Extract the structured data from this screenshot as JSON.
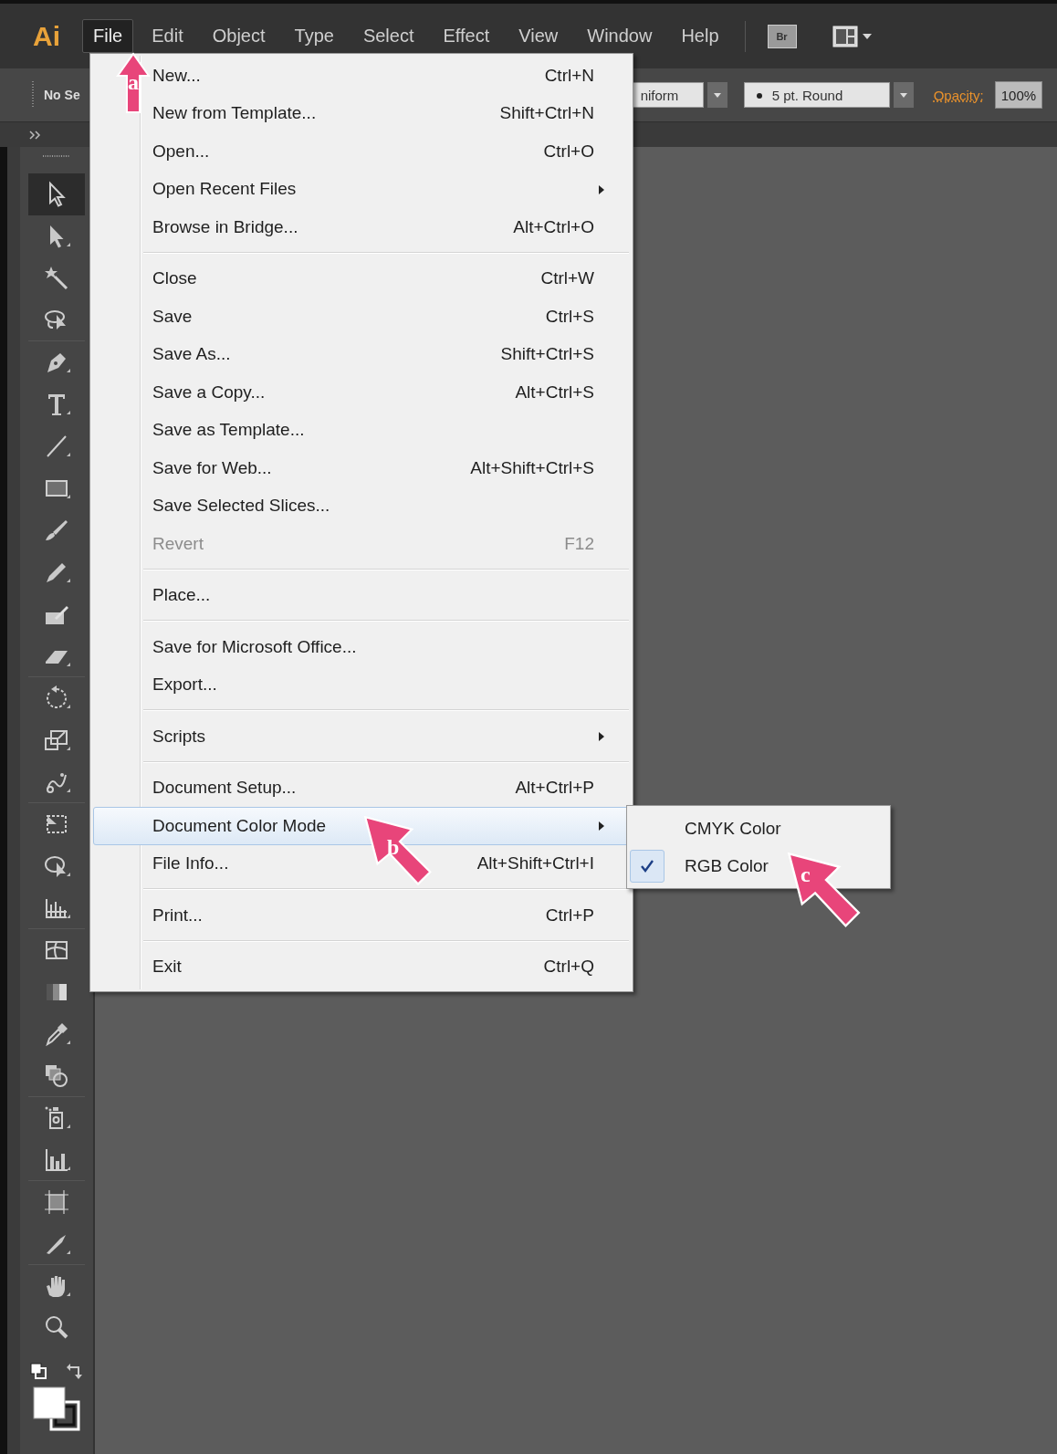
{
  "app_logo": "Ai",
  "menu_bar": {
    "items": [
      {
        "label": "File",
        "selected": true
      },
      {
        "label": "Edit",
        "selected": false
      },
      {
        "label": "Object",
        "selected": false
      },
      {
        "label": "Type",
        "selected": false
      },
      {
        "label": "Select",
        "selected": false
      },
      {
        "label": "Effect",
        "selected": false
      },
      {
        "label": "View",
        "selected": false
      },
      {
        "label": "Window",
        "selected": false
      },
      {
        "label": "Help",
        "selected": false
      }
    ],
    "bridge_button": "Br"
  },
  "control_bar": {
    "selection_label": "No Se",
    "stroke_profile": "niform",
    "brush": "5 pt. Round",
    "opacity_label": "Opacity:",
    "opacity_value": "100%"
  },
  "toolbar": {
    "tools": [
      {
        "selected": true
      },
      {
        "selected": false
      },
      {
        "selected": false
      },
      {
        "selected": false
      },
      {
        "selected": false
      },
      {
        "selected": false
      },
      {
        "selected": false
      },
      {
        "selected": false
      },
      {
        "selected": false
      },
      {
        "selected": false
      },
      {
        "selected": false
      },
      {
        "selected": false
      },
      {
        "selected": false
      },
      {
        "selected": false
      },
      {
        "selected": false
      },
      {
        "selected": false
      },
      {
        "selected": false
      },
      {
        "selected": false
      },
      {
        "selected": false
      },
      {
        "selected": false
      },
      {
        "selected": false
      },
      {
        "selected": false
      },
      {
        "selected": false
      },
      {
        "selected": false
      },
      {
        "selected": false
      },
      {
        "selected": false
      },
      {
        "selected": false
      },
      {
        "selected": false
      }
    ]
  },
  "file_menu": {
    "sections": [
      {
        "items": [
          {
            "label": "New...",
            "shortcut": "Ctrl+N",
            "has_submenu": false,
            "disabled": false,
            "selected": false
          },
          {
            "label": "New from Template...",
            "shortcut": "Shift+Ctrl+N",
            "has_submenu": false,
            "disabled": false,
            "selected": false
          },
          {
            "label": "Open...",
            "shortcut": "Ctrl+O",
            "has_submenu": false,
            "disabled": false,
            "selected": false
          },
          {
            "label": "Open Recent Files",
            "has_submenu": true,
            "disabled": false,
            "selected": false
          },
          {
            "label": "Browse in Bridge...",
            "shortcut": "Alt+Ctrl+O",
            "has_submenu": false,
            "disabled": false,
            "selected": false
          }
        ]
      },
      {
        "items": [
          {
            "label": "Close",
            "shortcut": "Ctrl+W",
            "has_submenu": false,
            "disabled": false,
            "selected": false
          },
          {
            "label": "Save",
            "shortcut": "Ctrl+S",
            "has_submenu": false,
            "disabled": false,
            "selected": false
          },
          {
            "label": "Save As...",
            "shortcut": "Shift+Ctrl+S",
            "has_submenu": false,
            "disabled": false,
            "selected": false
          },
          {
            "label": "Save a Copy...",
            "shortcut": "Alt+Ctrl+S",
            "has_submenu": false,
            "disabled": false,
            "selected": false
          },
          {
            "label": "Save as Template...",
            "has_submenu": false,
            "disabled": false,
            "selected": false
          },
          {
            "label": "Save for Web...",
            "shortcut": "Alt+Shift+Ctrl+S",
            "has_submenu": false,
            "disabled": false,
            "selected": false
          },
          {
            "label": "Save Selected Slices...",
            "has_submenu": false,
            "disabled": false,
            "selected": false
          },
          {
            "label": "Revert",
            "shortcut": "F12",
            "has_submenu": false,
            "disabled": true,
            "selected": false
          }
        ]
      },
      {
        "items": [
          {
            "label": "Place...",
            "has_submenu": false,
            "disabled": false,
            "selected": false
          }
        ]
      },
      {
        "items": [
          {
            "label": "Save for Microsoft Office...",
            "has_submenu": false,
            "disabled": false,
            "selected": false
          },
          {
            "label": "Export...",
            "has_submenu": false,
            "disabled": false,
            "selected": false
          }
        ]
      },
      {
        "items": [
          {
            "label": "Scripts",
            "has_submenu": true,
            "disabled": false,
            "selected": false
          }
        ]
      },
      {
        "items": [
          {
            "label": "Document Setup...",
            "shortcut": "Alt+Ctrl+P",
            "has_submenu": false,
            "disabled": false,
            "selected": false
          },
          {
            "label": "Document Color Mode",
            "has_submenu": true,
            "disabled": false,
            "selected": true
          },
          {
            "label": "File Info...",
            "shortcut": "Alt+Shift+Ctrl+I",
            "has_submenu": false,
            "disabled": false,
            "selected": false
          }
        ]
      },
      {
        "items": [
          {
            "label": "Print...",
            "shortcut": "Ctrl+P",
            "has_submenu": false,
            "disabled": false,
            "selected": false
          }
        ]
      },
      {
        "items": [
          {
            "label": "Exit",
            "shortcut": "Ctrl+Q",
            "has_submenu": false,
            "disabled": false,
            "selected": false
          }
        ]
      }
    ]
  },
  "color_mode_submenu": {
    "items": [
      {
        "label": "CMYK Color",
        "checked": false
      },
      {
        "label": "RGB Color",
        "checked": true
      }
    ]
  },
  "callouts": [
    {
      "label": "a"
    },
    {
      "label": "b"
    },
    {
      "label": "c"
    }
  ]
}
